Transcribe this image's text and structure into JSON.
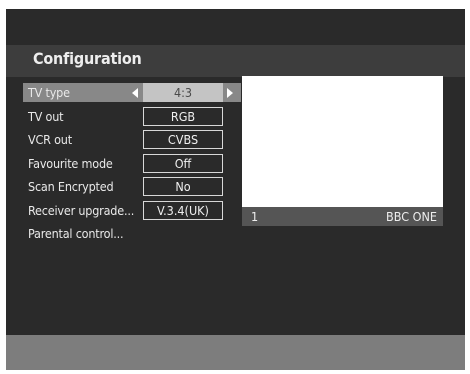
{
  "title": "Configuration",
  "menu": [
    {
      "label": "TV type",
      "value": "4:3",
      "selected": true
    },
    {
      "label": "TV out",
      "value": "RGB"
    },
    {
      "label": "VCR out",
      "value": "CVBS"
    },
    {
      "label": "Favourite mode",
      "value": "Off"
    },
    {
      "label": "Scan Encrypted",
      "value": "No"
    },
    {
      "label": "Receiver upgrade...",
      "value": "V.3.4(UK)"
    },
    {
      "label": "Parental control..."
    }
  ],
  "preview": {
    "channel_number": "1",
    "channel_name": "BBC ONE"
  },
  "icons": {
    "left": "arrow-left-icon",
    "right": "arrow-right-icon"
  },
  "colors": {
    "background": "#2a2a2a",
    "header": "#3d3d3d",
    "highlight": "#888888",
    "footer": "#7d7d7d"
  }
}
